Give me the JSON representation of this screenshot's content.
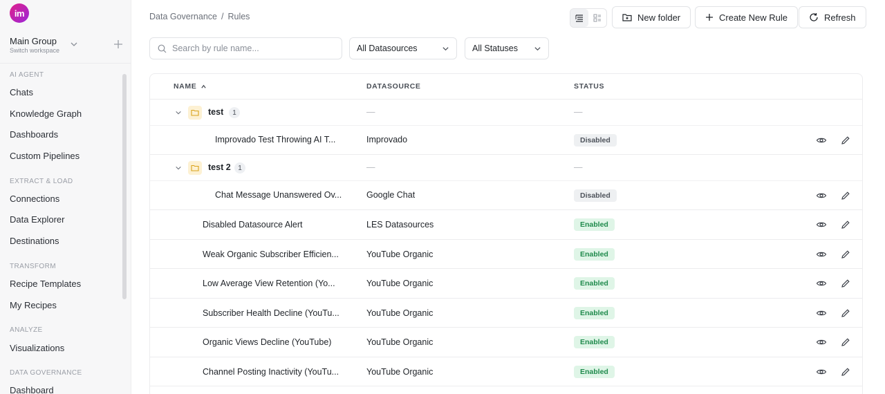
{
  "sidebar": {
    "logo_text": "im",
    "workspace_name": "Main Group",
    "workspace_sub": "Switch workspace",
    "sections": [
      {
        "label": "AI AGENT",
        "items": [
          "Chats",
          "Knowledge Graph",
          "Dashboards",
          "Custom Pipelines"
        ]
      },
      {
        "label": "EXTRACT & LOAD",
        "items": [
          "Connections",
          "Data Explorer",
          "Destinations"
        ]
      },
      {
        "label": "TRANSFORM",
        "items": [
          "Recipe Templates",
          "My Recipes"
        ]
      },
      {
        "label": "ANALYZE",
        "items": [
          "Visualizations"
        ]
      },
      {
        "label": "DATA GOVERNANCE",
        "items": [
          "Dashboard"
        ]
      }
    ]
  },
  "breadcrumb": {
    "parent": "Data Governance",
    "separator": "/",
    "current": "Rules"
  },
  "toolbar": {
    "new_folder": "New folder",
    "create_rule": "Create New Rule",
    "refresh": "Refresh"
  },
  "filters": {
    "search_placeholder": "Search by rule name...",
    "datasource": "All Datasources",
    "status": "All Statuses"
  },
  "table": {
    "headers": {
      "name": "NAME",
      "datasource": "DATASOURCE",
      "status": "STATUS"
    },
    "placeholder_dash": "—",
    "folders": [
      {
        "name": "test",
        "count": "1",
        "rules": [
          {
            "name": "Improvado Test Throwing AI T...",
            "datasource": "Improvado",
            "status": "Disabled"
          }
        ]
      },
      {
        "name": "test 2",
        "count": "1",
        "rules": [
          {
            "name": "Chat Message Unanswered Ov...",
            "datasource": "Google Chat",
            "status": "Disabled"
          }
        ]
      }
    ],
    "rules": [
      {
        "name": "Disabled Datasource Alert",
        "datasource": "LES Datasources",
        "status": "Enabled"
      },
      {
        "name": "Weak Organic Subscriber Efficien...",
        "datasource": "YouTube Organic",
        "status": "Enabled"
      },
      {
        "name": "Low Average View Retention (Yo...",
        "datasource": "YouTube Organic",
        "status": "Enabled"
      },
      {
        "name": "Subscriber Health Decline (YouTu...",
        "datasource": "YouTube Organic",
        "status": "Enabled"
      },
      {
        "name": "Organic Views Decline (YouTube)",
        "datasource": "YouTube Organic",
        "status": "Enabled"
      },
      {
        "name": "Channel Posting Inactivity (YouTu...",
        "datasource": "YouTube Organic",
        "status": "Enabled"
      }
    ]
  },
  "colors": {
    "accent": "#e0218a",
    "enabled_bg": "#dff5e7",
    "enabled_fg": "#1f8a4c",
    "disabled_bg": "#eef0f2"
  }
}
